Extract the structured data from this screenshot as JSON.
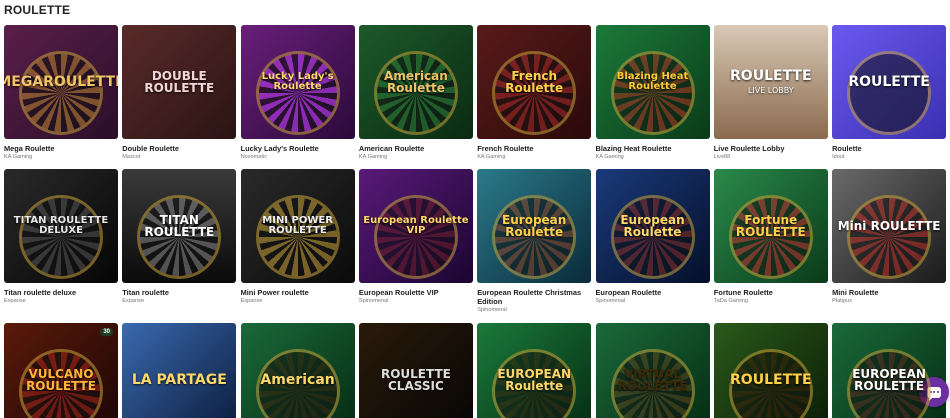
{
  "section": {
    "title": "ROULETTE"
  },
  "games": [
    {
      "name": "Mega Roulette",
      "provider": "KA Gaming",
      "art": "MEGAROULETTE",
      "bg": "linear-gradient(135deg,#5a1f4a,#2a0f28)",
      "fg": "#f2c46a",
      "wheel": "#b8862b"
    },
    {
      "name": "Double Roulette",
      "provider": "Mascot",
      "art": "DOUBLE ROULETTE",
      "bg": "linear-gradient(135deg,#5a2a2a,#2b1414)",
      "fg": "#f3d6d6",
      "wheel": ""
    },
    {
      "name": "Lucky Lady's Roulette",
      "provider": "Novomatic",
      "art": "Lucky Lady's Roulette",
      "bg": "linear-gradient(135deg,#6a1f7a,#2a0a3a)",
      "fg": "#ffd86a",
      "wheel": "#c843ff"
    },
    {
      "name": "American Roulette",
      "provider": "KA Gaming",
      "art": "American Roulette",
      "bg": "linear-gradient(135deg,#1d5a2a,#0a2a12)",
      "fg": "#f2c46a",
      "wheel": "#2f7a3a"
    },
    {
      "name": "French Roulette",
      "provider": "KA Gaming",
      "art": "French Roulette",
      "bg": "linear-gradient(135deg,#5a1a1a,#2a0a0a)",
      "fg": "#ffd24a",
      "wheel": "#a32a2a"
    },
    {
      "name": "Blazing Heat Roulette",
      "provider": "KA Gaming",
      "art": "Blazing Heat Roulette",
      "bg": "linear-gradient(135deg,#1c7a3a,#0a3a18)",
      "fg": "#ffcc33",
      "wheel": "#b3261e"
    },
    {
      "name": "Live Roulette Lobby",
      "provider": "Live88",
      "art": "ROULETTE",
      "sub": "LIVE LOBBY",
      "bg": "linear-gradient(180deg,#d9c9b5,#8a6a4e)",
      "fg": "#ffffff",
      "wheel": ""
    },
    {
      "name": "Roulette",
      "provider": "Idout",
      "art": "ROULETTE",
      "bg": "linear-gradient(135deg,#6a5af0,#3a2fb0)",
      "fg": "#ffffff",
      "wheel": "#111"
    },
    {
      "name": "Titan roulette deluxe",
      "provider": "Expanse",
      "art": "TITAN ROULETTE DELUXE",
      "bg": "linear-gradient(135deg,#2a2a2a,#050505)",
      "fg": "#e8e8e8",
      "wheel": "#555"
    },
    {
      "name": "Titan roulette",
      "provider": "Expanse",
      "art": "TITAN ROULETTE",
      "bg": "linear-gradient(180deg,#3a3a3a,#0a0a0a)",
      "fg": "#ffffff",
      "wheel": "#888"
    },
    {
      "name": "Mini Power roulette",
      "provider": "Expanse",
      "art": "MINI POWER ROULETTE",
      "bg": "linear-gradient(135deg,#2a2a2a,#0a0a0a)",
      "fg": "#f0f0f0",
      "wheel": "#c9a23a"
    },
    {
      "name": "European Roulette VIP",
      "provider": "Spinomenal",
      "art": "European Roulette VIP",
      "bg": "linear-gradient(135deg,#5a1a7a,#1a0530)",
      "fg": "#ffd86a",
      "wheel": "#6a1f1f"
    },
    {
      "name": "European Roulette Christmas Edition",
      "provider": "Spinomenal",
      "art": "European Roulette",
      "bg": "linear-gradient(135deg,#2a7a8a,#0a2a3a)",
      "fg": "#ffd24a",
      "wheel": "#8a3a1a"
    },
    {
      "name": "European Roulette",
      "provider": "Spinomenal",
      "art": "European Roulette",
      "bg": "linear-gradient(135deg,#1a3a7a,#050f2a)",
      "fg": "#ffd86a",
      "wheel": "#8a2a1a"
    },
    {
      "name": "Fortune Roulette",
      "provider": "TaDa Gaming",
      "art": "Fortune ROULETTE",
      "bg": "linear-gradient(135deg,#2a8a4a,#0a3a1a)",
      "fg": "#ffd24a",
      "wheel": "#c21f2a"
    },
    {
      "name": "Mini Roulette",
      "provider": "Platipus",
      "art": "Mini ROULETTE",
      "bg": "linear-gradient(135deg,#6a6a6a,#1a1a1a)",
      "fg": "#ffffff",
      "wheel": "#b3261e"
    },
    {
      "name": "",
      "provider": "",
      "art": "VULCANO ROULETTE",
      "badge": "30",
      "bg": "linear-gradient(135deg,#5a1a0a,#1a0505)",
      "fg": "#ffb43a",
      "wheel": "#a3261e"
    },
    {
      "name": "",
      "provider": "",
      "art": "LA PARTAGE",
      "bg": "linear-gradient(135deg,#3a6ab0,#0a1a3a)",
      "fg": "#ffd86a",
      "wheel": ""
    },
    {
      "name": "",
      "provider": "",
      "art": "American",
      "bg": "linear-gradient(135deg,#1a6a3a,#052a12)",
      "fg": "#ffd86a",
      "wheel": "#3a1a0a"
    },
    {
      "name": "",
      "provider": "",
      "art": "ROULETTE CLASSIC",
      "bg": "linear-gradient(135deg,#2a1a0a,#050505)",
      "fg": "#dddddd",
      "wheel": ""
    },
    {
      "name": "",
      "provider": "",
      "art": "EUROPEAN Roulette",
      "bg": "linear-gradient(135deg,#1a7a3a,#052a12)",
      "fg": "#ffd86a",
      "wheel": "#3a1a0a"
    },
    {
      "name": "",
      "provider": "",
      "art": "VIRTUAL ROULETTE",
      "bg": "linear-gradient(135deg,#1a6a3a,#052a12)",
      "fg": "#3a2a0a",
      "wheel": "#5a3a1a"
    },
    {
      "name": "",
      "provider": "",
      "art": "ROULETTE",
      "bg": "linear-gradient(135deg,#2a5a1a,#0a1a05)",
      "fg": "#ffd24a",
      "wheel": "#3a1a0a"
    },
    {
      "name": "",
      "provider": "",
      "art": "EUROPEAN ROULETTE",
      "bg": "linear-gradient(135deg,#1a6a3a,#052a12)",
      "fg": "#ffffff",
      "wheel": "#5a1a1a"
    }
  ]
}
